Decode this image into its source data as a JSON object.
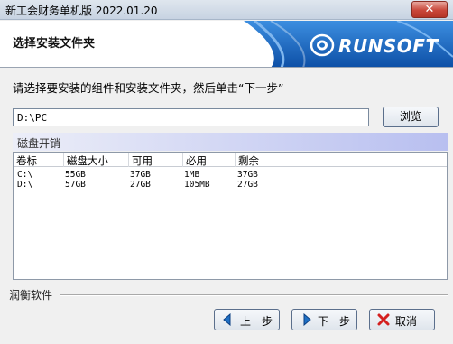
{
  "window": {
    "title": "新工会财务单机版 2022.01.20",
    "close_symbol": "✕"
  },
  "header": {
    "title": "选择安装文件夹",
    "logo_text": "RUNSOFT"
  },
  "instruction": "请选择要安装的组件和安装文件夹，然后单击“下一步”",
  "path": {
    "value": "D:\\PC"
  },
  "browse_button": "浏览",
  "disk_section": {
    "title": "磁盘开销",
    "columns": [
      "卷标",
      "磁盘大小",
      "可用",
      "必用",
      "剩余"
    ],
    "rows": [
      [
        "C:\\",
        "55GB",
        "37GB",
        "1MB",
        "37GB"
      ],
      [
        "D:\\",
        "57GB",
        "27GB",
        "105MB",
        "27GB"
      ]
    ]
  },
  "footer": {
    "brand": "润衡软件",
    "prev_button": "上一步",
    "next_button": "下一步",
    "cancel_button": "取消"
  },
  "icons": {
    "prev": "left-arrow-icon",
    "next": "right-arrow-icon",
    "cancel": "x-icon"
  },
  "colors": {
    "accent_blue": "#1e6fc4",
    "group_header": "#b8bff0",
    "cancel_red": "#d42020"
  }
}
